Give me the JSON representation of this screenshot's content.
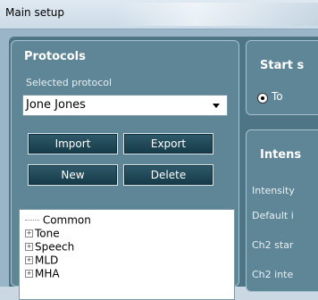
{
  "window": {
    "title": "Main setup"
  },
  "protocols": {
    "header": "Protocols",
    "selected_label": "Selected protocol",
    "selected_value": "Jone Jones",
    "buttons": {
      "import": "Import",
      "export": "Export",
      "new": "New",
      "delete": "Delete"
    },
    "tree": [
      {
        "label": "Common",
        "expandable": false
      },
      {
        "label": "Tone",
        "expandable": true
      },
      {
        "label": "Speech",
        "expandable": true
      },
      {
        "label": "MLD",
        "expandable": true
      },
      {
        "label": "MHA",
        "expandable": true
      }
    ]
  },
  "start": {
    "header": "Start s",
    "option_label": "To"
  },
  "intensity": {
    "header": "Intens",
    "rows": [
      "Intensity",
      "Default i",
      "Ch2 star",
      "Ch2 inte"
    ]
  },
  "icons": {
    "expand": "plus-box-icon",
    "dropdown": "chevron-down-icon",
    "radio": "radio-selected-icon"
  }
}
